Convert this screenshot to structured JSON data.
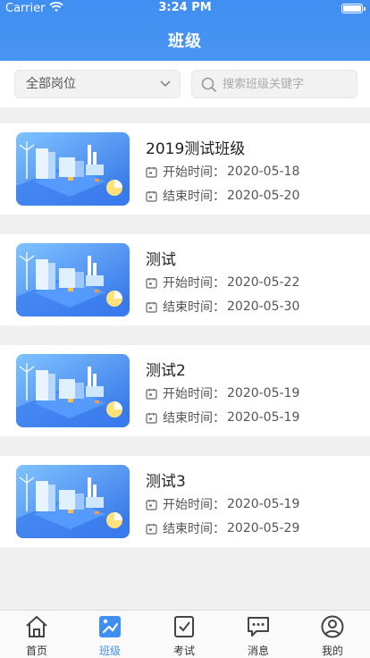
{
  "status_bar": {
    "carrier": "Carrier",
    "time": "3:24 PM"
  },
  "header": {
    "title": "班级"
  },
  "filter": {
    "position_select": "全部岗位",
    "search_placeholder": "搜索班级关键字"
  },
  "classes": [
    {
      "name": "2019测试班级",
      "start_label": "开始时间：",
      "start_date": "2020-05-18",
      "end_label": "结束时间：",
      "end_date": "2020-05-20"
    },
    {
      "name": "测试",
      "start_label": "开始时间：",
      "start_date": "2020-05-22",
      "end_label": "结束时间：",
      "end_date": "2020-05-30"
    },
    {
      "name": "测试2",
      "start_label": "开始时间：",
      "start_date": "2020-05-19",
      "end_label": "结束时间：",
      "end_date": "2020-05-19"
    },
    {
      "name": "测试3",
      "start_label": "开始时间：",
      "start_date": "2020-05-19",
      "end_label": "结束时间：",
      "end_date": "2020-05-29"
    }
  ],
  "tabbar": {
    "items": [
      {
        "label": "首页",
        "icon": "home-icon"
      },
      {
        "label": "班级",
        "icon": "class-icon",
        "active": true
      },
      {
        "label": "考试",
        "icon": "exam-icon"
      },
      {
        "label": "消息",
        "icon": "message-icon"
      },
      {
        "label": "我的",
        "icon": "profile-icon"
      }
    ]
  },
  "colors": {
    "accent": "#3f8ef1",
    "background": "#f0f0f0"
  }
}
